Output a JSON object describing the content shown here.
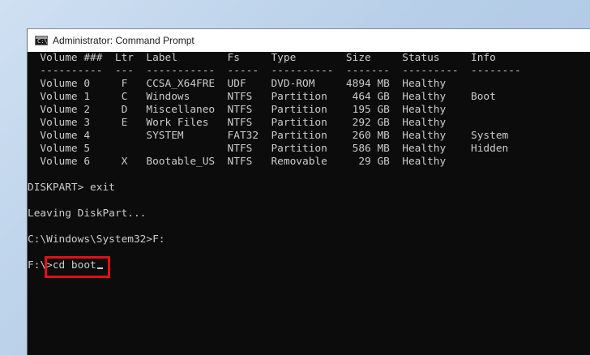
{
  "window": {
    "title": "Administrator: Command Prompt",
    "icon_glyph": "C:\\"
  },
  "console": {
    "lines": [
      "  Volume ###  Ltr  Label        Fs     Type        Size     Status     Info",
      "  ----------  ---  -----------  -----  ----------  -------  ---------  --------",
      "  Volume 0     F   CCSA_X64FRE  UDF    DVD-ROM     4894 MB  Healthy",
      "  Volume 1     C   Windows      NTFS   Partition    464 GB  Healthy    Boot",
      "  Volume 2     D   Miscellaneo  NTFS   Partition    195 GB  Healthy",
      "  Volume 3     E   Work Files   NTFS   Partition    292 GB  Healthy",
      "  Volume 4         SYSTEM       FAT32  Partition    260 MB  Healthy    System",
      "  Volume 5                      NTFS   Partition    586 MB  Healthy    Hidden",
      "  Volume 6     X   Bootable_US  NTFS   Removable     29 GB  Healthy",
      "",
      "DISKPART> exit",
      "",
      "Leaving DiskPart...",
      "",
      "C:\\Windows\\System32>F:",
      "",
      "F:\\>cd boot"
    ]
  },
  "annotation": {
    "highlight_color": "#e0101a"
  }
}
